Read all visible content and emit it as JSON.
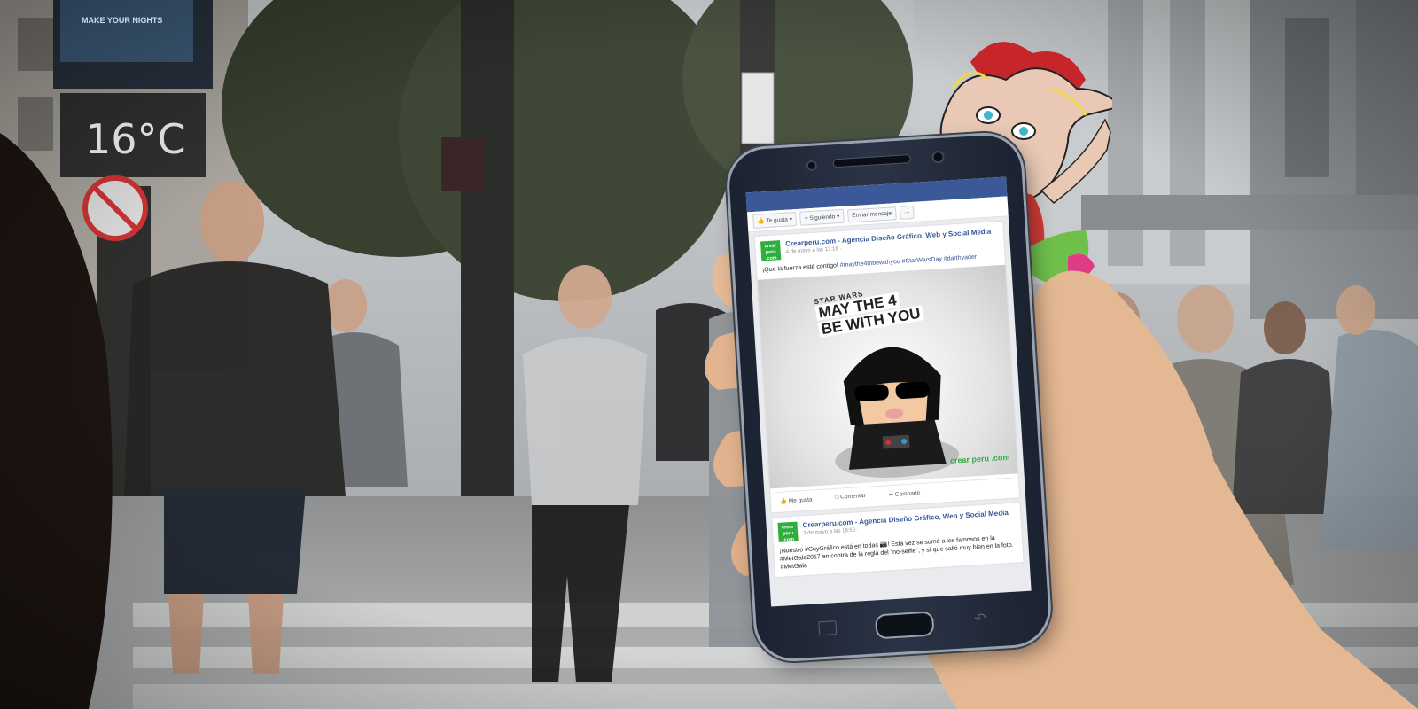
{
  "scene": {
    "sign_text": "MAKE YOUR NIGHTS",
    "thermometer": "16°C"
  },
  "fb": {
    "tabs": [
      "Te gusta",
      "Siguiendo",
      "Enviar mensaje",
      "···"
    ],
    "posts": [
      {
        "page_name": "Crearperu.com - Agencia Diseño Gráfico, Web y Social Media",
        "date": "4 de mayo a las 13:18 ·",
        "text_plain": "¡Que la fuerza esté contigo! ",
        "hashtags": "#maythe4thbewithyou #StarWarsDay #darthvader",
        "image_top": "STAR WARS",
        "image_line1": "MAY THE 4",
        "image_line2": "BE WITH YOU",
        "watermark": "crear peru .com",
        "actions": [
          "Me gusta",
          "Comentar",
          "Compartir"
        ]
      },
      {
        "page_name": "Crearperu.com - Agencia Diseño Gráfico, Web y Social Media",
        "date": "3 de mayo a las 18:50 ·",
        "text": "¡Nuestro #CuyGráfico está en todas 📸! Esta vez se sumó a los famosos en la #MetGala2017 en contra de la regla del \"no-selfie\", y sí que salió muy bien en la foto. #MetGala"
      }
    ],
    "logo_text": "crear peru .com"
  }
}
